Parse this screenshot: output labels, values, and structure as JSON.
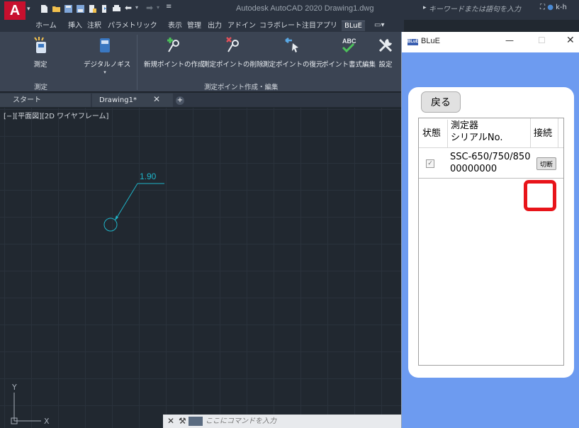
{
  "app": {
    "logo_letter": "A",
    "window_title": "Autodesk AutoCAD 2020    Drawing1.dwg",
    "search_placeholder": "キーワードまたは語句を入力",
    "user_label": "k-h"
  },
  "ribbon_tabs": [
    {
      "label": "ホーム"
    },
    {
      "label": "挿入"
    },
    {
      "label": "注釈"
    },
    {
      "label": "パラメトリック"
    },
    {
      "label": "表示"
    },
    {
      "label": "管理"
    },
    {
      "label": "出力"
    },
    {
      "label": "アドイン"
    },
    {
      "label": "コラボレート"
    },
    {
      "label": "注目アプリ"
    },
    {
      "label": "BLuE"
    }
  ],
  "ribbon_buttons": {
    "measure": "測定",
    "caliper": "デジタルノギス",
    "new_point": "新規ポイントの作成",
    "delete_point": "測定ポイントの削除",
    "restore_point": "測定ポイントの復元",
    "point_format": "ポイント書式編集",
    "settings": "設定"
  },
  "ribbon_panels": {
    "measure_panel": "測定",
    "edit_panel": "測定ポイント作成・編集"
  },
  "doc_tabs": {
    "start": "スタート",
    "drawing": "Drawing1*",
    "close": "✕",
    "add": "+"
  },
  "canvas": {
    "viewport_label": "[−][平面図][2D ワイヤフレーム]",
    "dimension_value": "1.90",
    "axis_y": "Y",
    "axis_x": "X"
  },
  "command_line": {
    "placeholder": "ここにコマンドを入力"
  },
  "blue_window": {
    "icon_text": "BLuE",
    "title": "BLuE",
    "back_label": "戻る",
    "headers": {
      "status": "状態",
      "serial_line1": "測定器",
      "serial_line2": "シリアルNo.",
      "connect": "接続"
    },
    "rows": [
      {
        "checked": true,
        "serial_line1": "SSC-650/750/850",
        "serial_line2": "00000000",
        "action": "切断"
      }
    ]
  },
  "colors": {
    "accent_blue": "#6d9bf0",
    "highlight": "#e8141a",
    "dimension": "#1fb5c9"
  }
}
